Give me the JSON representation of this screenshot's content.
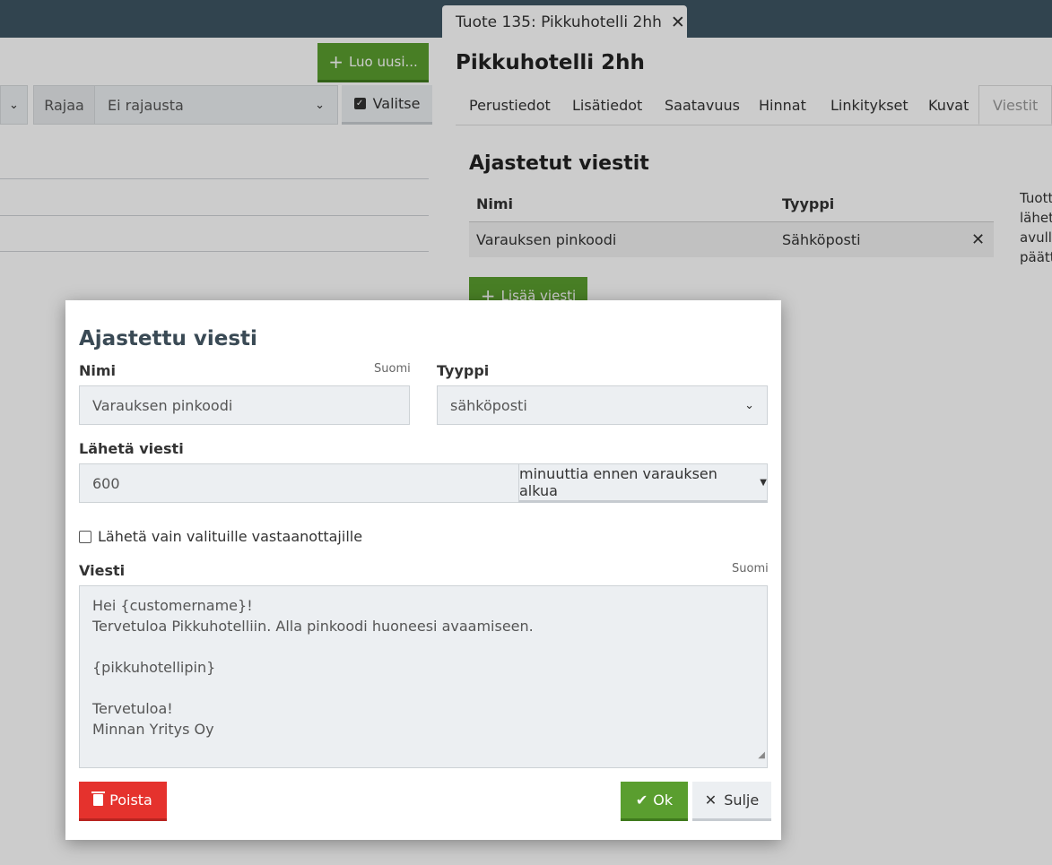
{
  "doc_tab": {
    "title": "Tuote 135: Pikkuhotelli 2hh",
    "close": "✕"
  },
  "left": {
    "create_button": "Luo uusi...",
    "filter_label": "Rajaa",
    "filter_value": "Ei rajausta",
    "select_button": "Valitse"
  },
  "product": {
    "title": "Pikkuhotelli 2hh",
    "tabs": [
      "Perustiedot",
      "Lisätiedot",
      "Saatavuus",
      "Hinnat",
      "Linkitykset",
      "Kuvat",
      "Viestit"
    ],
    "section_title": "Ajastetut viestit",
    "table": {
      "headers": [
        "Nimi",
        "Tyyppi"
      ],
      "rows": [
        {
          "name": "Varauksen pinkoodi",
          "type": "Sähköposti"
        }
      ]
    },
    "side_text": [
      "Tuott",
      "lähet",
      "avull",
      "päätt"
    ],
    "add_button": "Lisää viesti"
  },
  "modal": {
    "title": "Ajastettu viesti",
    "name_label": "Nimi",
    "name_lang": "Suomi",
    "name_value": "Varauksen pinkoodi",
    "type_label": "Tyyppi",
    "type_value": "sähköposti",
    "send_label": "Lähetä viesti",
    "send_value": "600",
    "send_unit": "minuuttia ennen varauksen alkua",
    "checkbox_label": "Lähetä vain valituille vastaanottajille",
    "message_label": "Viesti",
    "message_lang": "Suomi",
    "message_lines": [
      "Hei {customername}!",
      "Tervetuloa Pikkuhotelliin. Alla pinkoodi huoneesi avaamiseen.",
      "",
      "{pikkuhotellipin}",
      "",
      "Tervetuloa!",
      "Minnan Yritys Oy"
    ],
    "delete_button": "Poista",
    "ok_button": "Ok",
    "close_button": "Sulje"
  },
  "colors": {
    "topbar": "#3e5563",
    "primary": "#5a9e2f",
    "danger": "#e5322d"
  }
}
